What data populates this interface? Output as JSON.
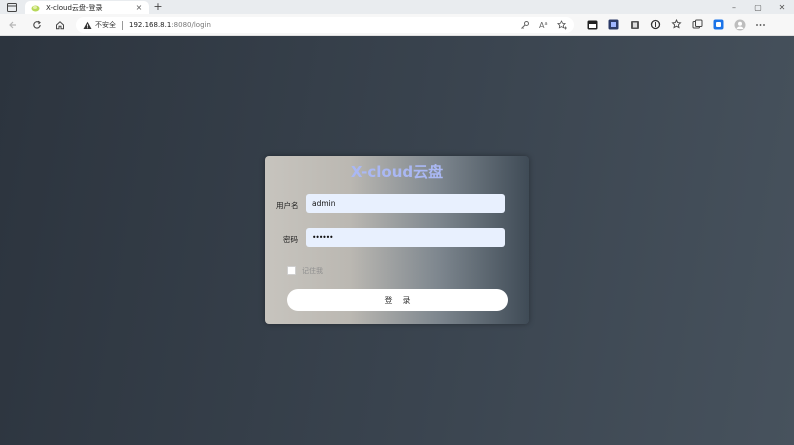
{
  "browser": {
    "tab_title": "X-cloud云盘-登录",
    "security_label": "不安全",
    "url_host": "192.168.8.1",
    "url_rest": ":8080/login"
  },
  "login": {
    "title": "X-cloud云盘",
    "username_label": "用户名",
    "username_value": "admin",
    "password_label": "密码",
    "password_value": "••••••",
    "remember_label": "记住我",
    "submit_label": "登录"
  },
  "colors": {
    "title": "#aab8f4",
    "input_bg": "#e8f0fe",
    "page_bg": "#353f4a"
  },
  "icons": [
    "window-icon",
    "favicon-icon",
    "close-icon",
    "plus-icon",
    "back-icon",
    "refresh-icon",
    "home-icon",
    "warning-icon",
    "key-icon",
    "read-aloud-icon",
    "add-favorite-icon",
    "extension-icon",
    "favorites-icon",
    "collections-icon",
    "profile-icon",
    "more-icon"
  ]
}
